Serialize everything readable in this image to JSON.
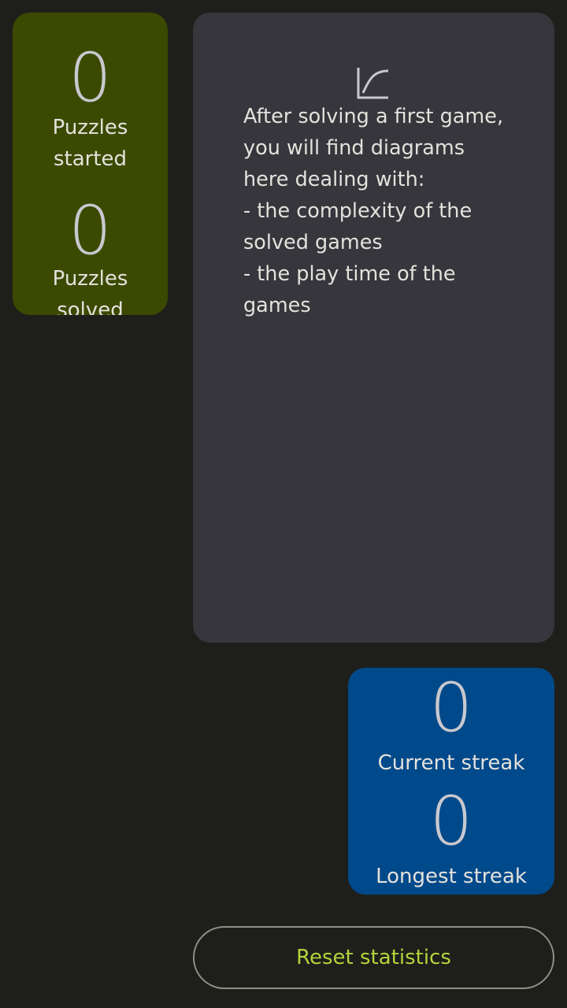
{
  "puzzles": {
    "started_value": "0",
    "started_label": "Puzzles\nstarted",
    "solved_value": "0",
    "solved_label": "Puzzles\nsolved"
  },
  "diagrams": {
    "icon": "chart-curve-icon",
    "message": "After solving a first game, you will find diagrams here dealing with:\n- the complexity of the solved games\n- the play time of the games"
  },
  "streak": {
    "current_value": "0",
    "current_label": "Current streak",
    "longest_value": "0",
    "longest_label": "Longest streak"
  },
  "actions": {
    "reset_label": "Reset statistics"
  },
  "colors": {
    "background": "#1e1f1a",
    "puzzles_card": "#3b4a00",
    "diagrams_card": "#36363c",
    "streak_card": "#00498a",
    "accent": "#b4d33c"
  }
}
